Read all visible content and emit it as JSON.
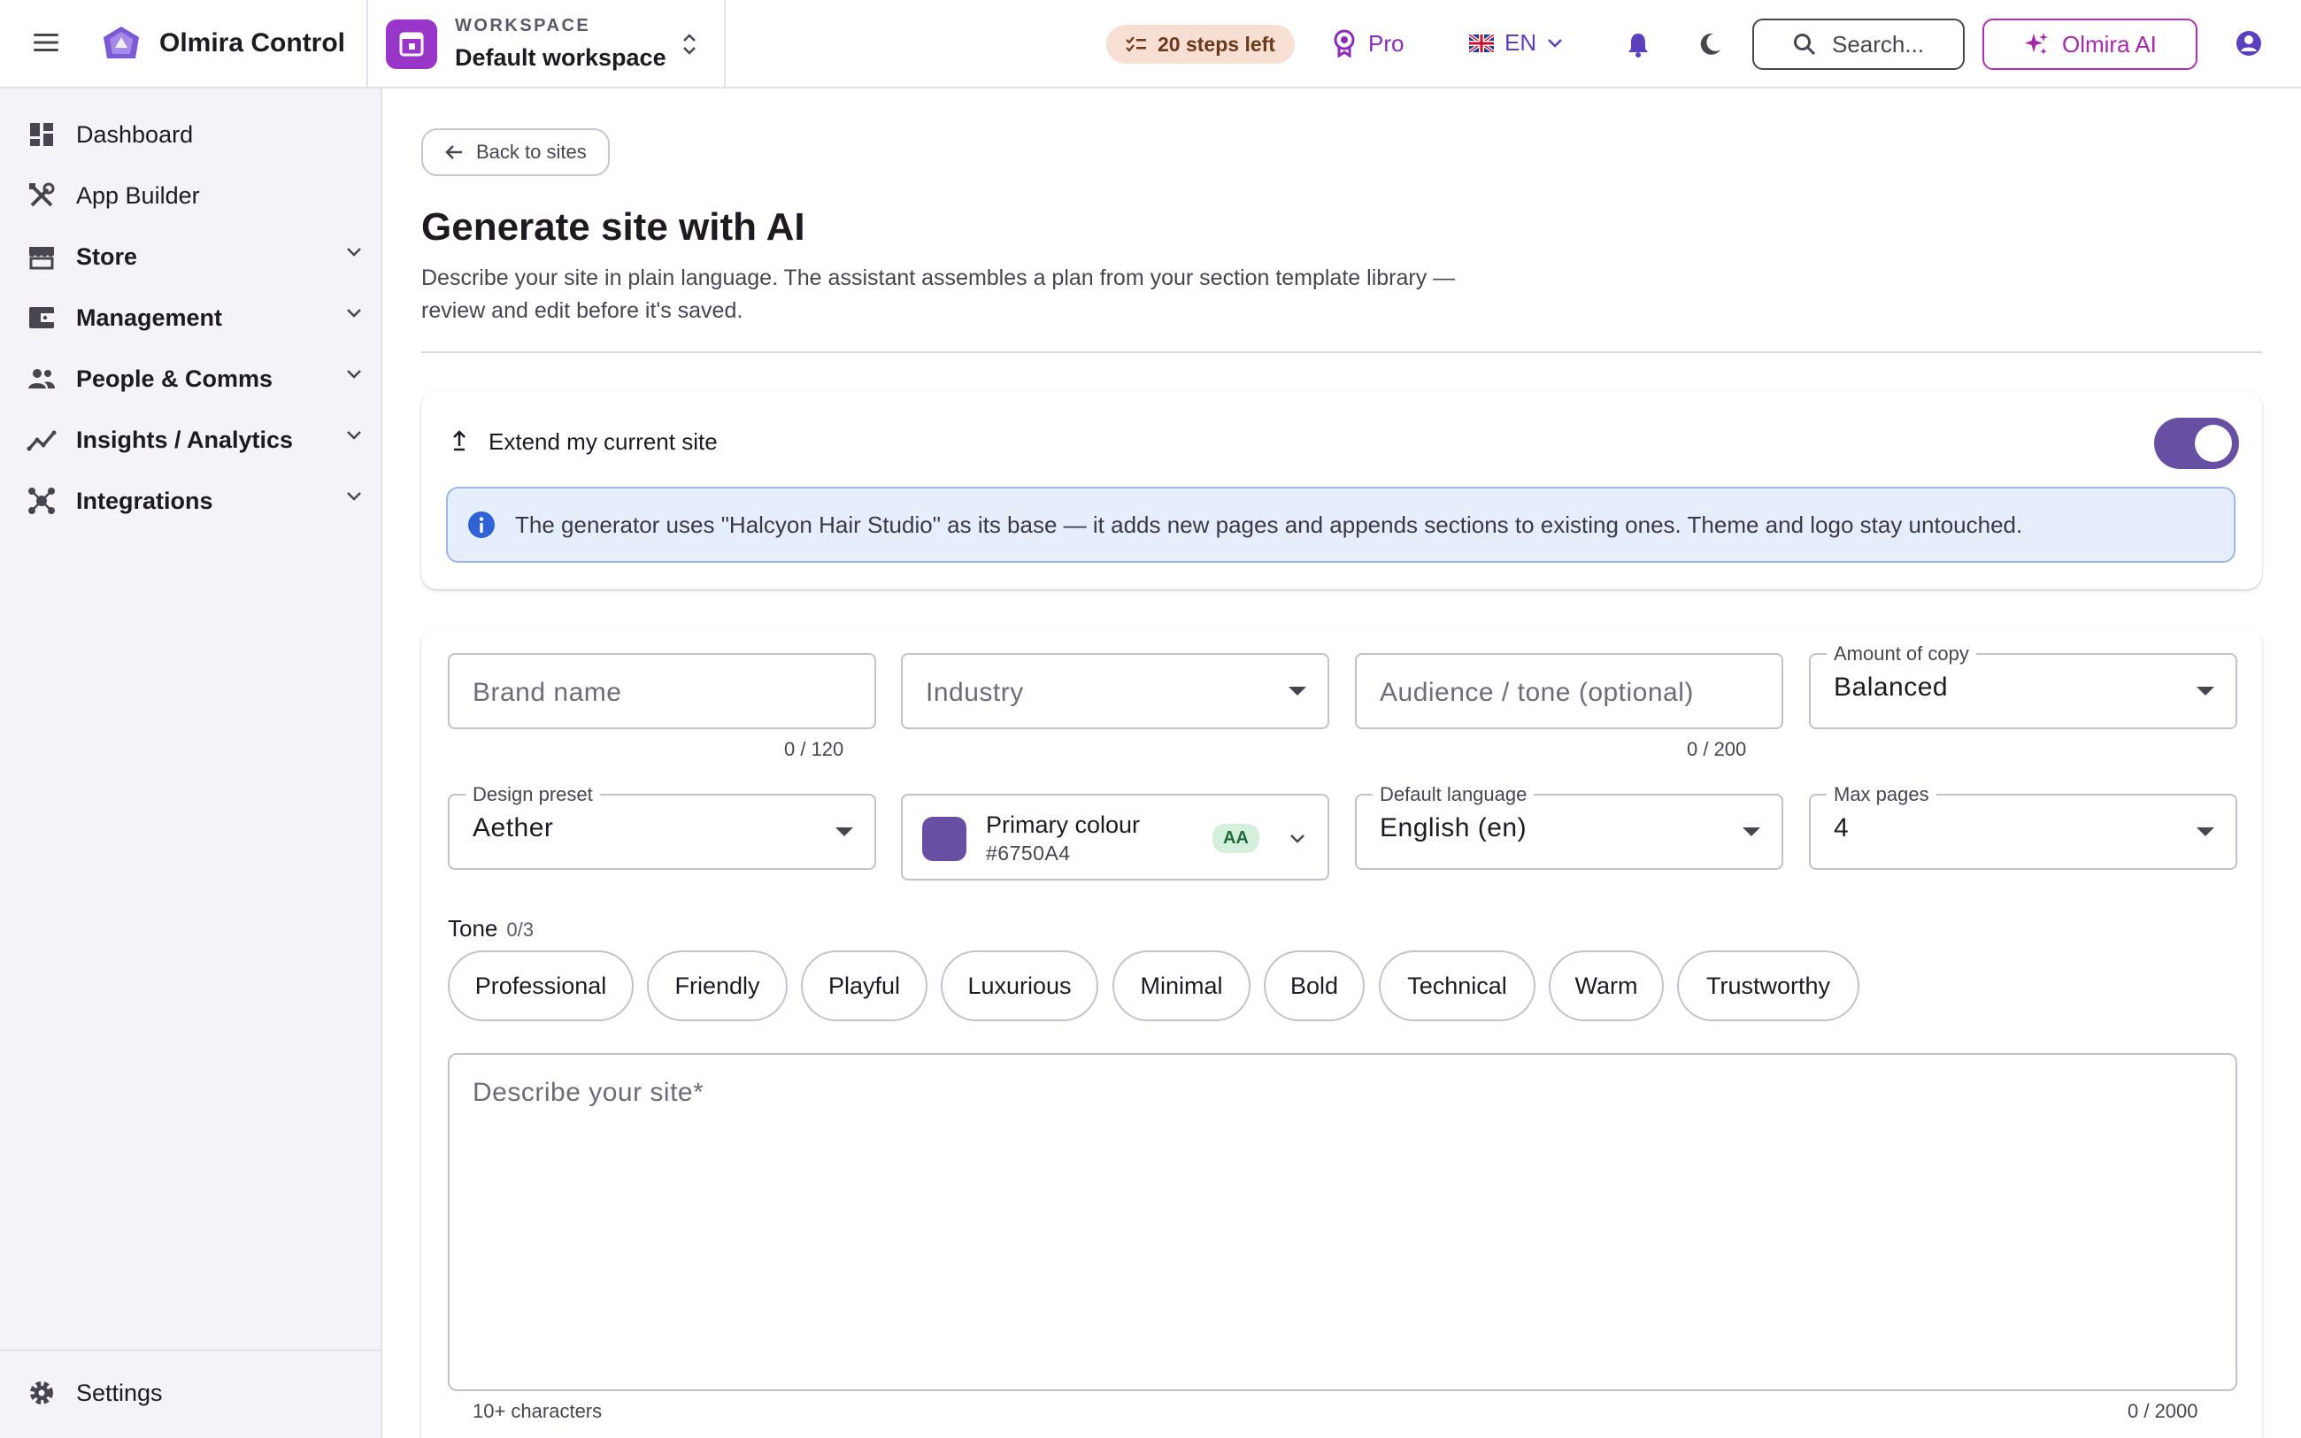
{
  "header": {
    "app_title": "Olmira Control",
    "workspace_label": "WORKSPACE",
    "workspace_name": "Default workspace",
    "steps_left": "20 steps left",
    "plan": "Pro",
    "language": "EN",
    "search_placeholder": "Search...",
    "ai_button": "Olmira AI"
  },
  "sidebar": {
    "items": [
      {
        "label": "Dashboard",
        "icon": "dashboard-icon",
        "expandable": false
      },
      {
        "label": "App Builder",
        "icon": "build-tools-icon",
        "expandable": false
      },
      {
        "label": "Store",
        "icon": "storefront-icon",
        "expandable": true
      },
      {
        "label": "Management",
        "icon": "wallet-icon",
        "expandable": true
      },
      {
        "label": "People & Comms",
        "icon": "people-icon",
        "expandable": true
      },
      {
        "label": "Insights / Analytics",
        "icon": "analytics-icon",
        "expandable": true
      },
      {
        "label": "Integrations",
        "icon": "hub-icon",
        "expandable": true
      }
    ],
    "settings_label": "Settings"
  },
  "main": {
    "back_label": "Back to sites",
    "title": "Generate site with AI",
    "description": "Describe your site in plain language. The assistant assembles a plan from your section template library — review and edit before it's saved.",
    "extend_label": "Extend my current site",
    "extend_enabled": true,
    "info_text": "The generator uses \"Halcyon Hair Studio\" as its base — it adds new pages and appends sections to existing ones. Theme and logo stay untouched.",
    "form": {
      "brand_placeholder": "Brand name",
      "brand_counter": "0 / 120",
      "industry_placeholder": "Industry",
      "audience_placeholder": "Audience / tone (optional)",
      "audience_counter": "0 / 200",
      "amount_label": "Amount of copy",
      "amount_value": "Balanced",
      "preset_label": "Design preset",
      "preset_value": "Aether",
      "colour_label": "Primary colour",
      "colour_hex": "#6750A4",
      "colour_contrast": "AA",
      "language_label": "Default language",
      "language_value": "English (en)",
      "maxpages_label": "Max pages",
      "maxpages_value": "4",
      "tone_label": "Tone",
      "tone_count": "0/3",
      "tones": [
        "Professional",
        "Friendly",
        "Playful",
        "Luxurious",
        "Minimal",
        "Bold",
        "Technical",
        "Warm",
        "Trustworthy"
      ],
      "describe_placeholder": "Describe your site*",
      "describe_hint": "10+ characters",
      "describe_counter": "0 / 2000"
    }
  },
  "colors": {
    "primary": "#6750A4",
    "accent_ai": "#A42AA9",
    "info_bg": "#E7EEFB"
  }
}
